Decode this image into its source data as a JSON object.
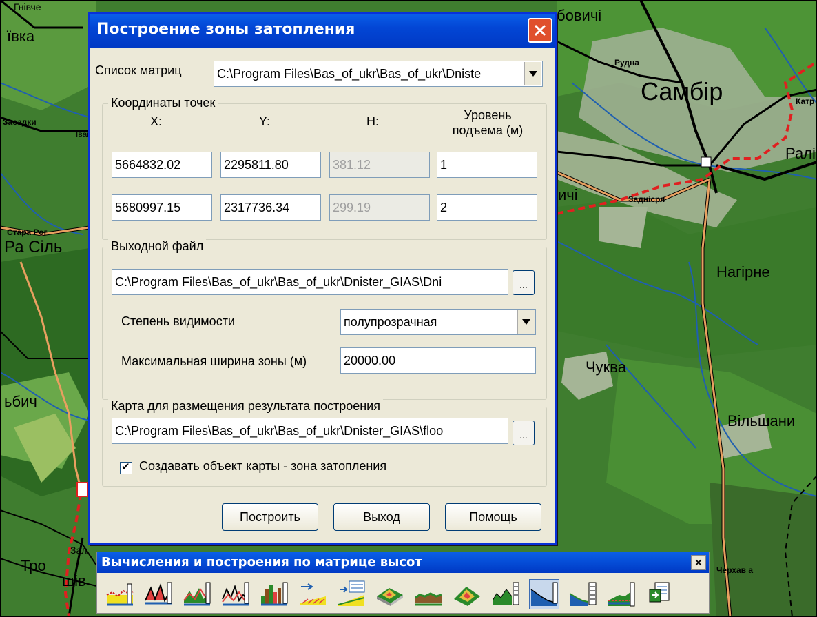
{
  "map": {
    "labels": [
      "ївка",
      "Гнівче",
      "Засадки",
      "Іван",
      "Стара Рог",
      "Ра Сіль",
      "ьбич",
      "Тро",
      "щів",
      "Зал",
      "бовичі",
      "Рудна",
      "Самбір",
      "Ралі",
      "Катр",
      "Заднісря",
      "Нагірне",
      "Чуква",
      "Вільшани",
      "ичі",
      "Черхав а"
    ],
    "colors": {
      "dark_green": "#3d7a2e",
      "mid_green": "#4f9a3c",
      "light_green": "#78b55a",
      "town": "#a8b89a",
      "road": "#000000",
      "river": "#1f5fb0",
      "highway": "#e8a060",
      "border": "#e02020"
    }
  },
  "dialog": {
    "title": "Построение зоны затопления",
    "close_icon": "close-icon",
    "matrices_label": "Список матриц",
    "matrices_value": "C:\\Program Files\\Bas_of_ukr\\Bas_of_ukr\\Dniste",
    "coords_group": "Координаты точек",
    "col_x": "X:",
    "col_y": "Y:",
    "col_h": "H:",
    "col_level": "Уровень подъема (м)",
    "points": [
      {
        "x": "5664832.02",
        "y": "2295811.80",
        "h": "381.12",
        "level": "1"
      },
      {
        "x": "5680997.15",
        "y": "2317736.34",
        "h": "299.19",
        "level": "2"
      }
    ],
    "output_group": "Выходной файл",
    "output_path": "C:\\Program Files\\Bas_of_ukr\\Bas_of_ukr\\Dnister_GIAS\\Dni",
    "browse_label": "...",
    "visibility_label": "Степень видимости",
    "visibility_value": "полупрозрачная",
    "max_width_label": "Максимальная ширина зоны (м)",
    "max_width_value": "20000.00",
    "map_group": "Карта для размещения результата построения",
    "map_path": "C:\\Program Files\\Bas_of_ukr\\Bas_of_ukr\\Dnister_GIAS\\floo",
    "create_object_label": "Создавать объект карты - зона затопления",
    "create_object_checked": true,
    "btn_build": "Построить",
    "btn_exit": "Выход",
    "btn_help": "Помощь"
  },
  "toolbar": {
    "title": "Вычисления и построения по матрице высот",
    "close_label": "×",
    "tools": [
      "profile-tool-icon",
      "section-tool-icon",
      "multi-section-tool-icon",
      "profile-compare-tool-icon",
      "histogram-tool-icon",
      "slope-tool-icon",
      "slope-table-tool-icon",
      "relief-3d-tool-icon",
      "terrain-strip-tool-icon",
      "hill-3d-tool-icon",
      "profile-frame-tool-icon",
      "flood-zone-tool-icon",
      "flood-table-tool-icon",
      "level-line-tool-icon",
      "export-tool-icon"
    ]
  }
}
